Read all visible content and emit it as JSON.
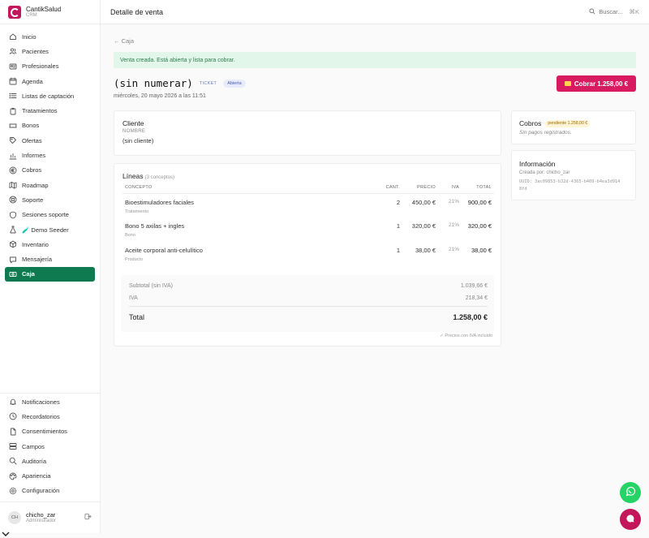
{
  "brand": {
    "name": "CantikSalud",
    "sub": "CRM"
  },
  "nav": [
    {
      "id": "inicio",
      "label": "Inicio",
      "icon": "home-icon"
    },
    {
      "id": "pacientes",
      "label": "Pacientes",
      "icon": "users-icon"
    },
    {
      "id": "profesionales",
      "label": "Profesionales",
      "icon": "id-card-icon"
    },
    {
      "id": "agenda",
      "label": "Agenda",
      "icon": "calendar-icon"
    },
    {
      "id": "listas",
      "label": "Listas de captación",
      "icon": "list-icon"
    },
    {
      "id": "tratamientos",
      "label": "Tratamientos",
      "icon": "clipboard-icon"
    },
    {
      "id": "bonos",
      "label": "Bonos",
      "icon": "ticket-icon"
    },
    {
      "id": "ofertas",
      "label": "Ofertas",
      "icon": "tag-icon"
    },
    {
      "id": "informes",
      "label": "Informes",
      "icon": "chart-icon"
    },
    {
      "id": "cobros",
      "label": "Cobros",
      "icon": "euro-icon"
    },
    {
      "id": "roadmap",
      "label": "Roadmap",
      "icon": "map-icon"
    },
    {
      "id": "soporte",
      "label": "Soporte",
      "icon": "lifebuoy-icon"
    },
    {
      "id": "sesiones",
      "label": "Sesiones soporte",
      "icon": "shield-icon"
    },
    {
      "id": "demo",
      "label": "🧪 Demo Seeder",
      "icon": "flask-icon"
    },
    {
      "id": "inventario",
      "label": "Inventario",
      "icon": "box-icon"
    },
    {
      "id": "mensajeria",
      "label": "Mensajería",
      "icon": "message-icon"
    },
    {
      "id": "caja",
      "label": "Caja",
      "icon": "cash-icon",
      "active": true
    }
  ],
  "nav_bottom": [
    {
      "id": "notificaciones",
      "label": "Notificaciones",
      "icon": "bell-icon"
    },
    {
      "id": "recordatorios",
      "label": "Recordatorios",
      "icon": "clock-icon"
    },
    {
      "id": "consentimientos",
      "label": "Consentimientos",
      "icon": "file-icon"
    },
    {
      "id": "campos",
      "label": "Campos",
      "icon": "fields-icon"
    },
    {
      "id": "auditoria",
      "label": "Auditoría",
      "icon": "search-icon"
    },
    {
      "id": "apariencia",
      "label": "Apariencia",
      "icon": "palette-icon"
    },
    {
      "id": "configuracion",
      "label": "Configuración",
      "icon": "gear-icon"
    }
  ],
  "user": {
    "initials": "CH",
    "name": "chicho_zar",
    "role": "Administrador"
  },
  "topbar": {
    "title": "Detalle de venta",
    "search_placeholder": "Buscar...",
    "search_shortcut": "⌘K"
  },
  "page": {
    "back_label": "← Caja",
    "alert": "Venta creada. Está abierta y lista para cobrar.",
    "title": "(sin numerar)",
    "tag": "TICKET",
    "status": "Abierta",
    "date": "miércoles, 20 mayo 2026 a las 11:51",
    "cobrar_button": "Cobrar  1.258,00 €"
  },
  "cliente": {
    "title": "Cliente",
    "label": "NOMBRE",
    "value": "(sin cliente)"
  },
  "lineas": {
    "title": "Líneas",
    "count": "(3 conceptos)",
    "headers": {
      "concepto": "CONCEPTO",
      "cant": "CANT.",
      "precio": "PRECIO",
      "iva": "IVA",
      "total": "TOTAL"
    },
    "rows": [
      {
        "concepto": "Bioestimuladores faciales",
        "tipo": "Tratamiento",
        "cant": "2",
        "precio": "450,00 €",
        "iva": "21%",
        "total": "900,00 €"
      },
      {
        "concepto": "Bono 5 axilas + ingles",
        "tipo": "Bono",
        "cant": "1",
        "precio": "320,00 €",
        "iva": "21%",
        "total": "320,00 €"
      },
      {
        "concepto": "Aceite corporal anti-celulítico",
        "tipo": "Producto",
        "cant": "1",
        "precio": "38,00 €",
        "iva": "21%",
        "total": "38,00 €"
      }
    ],
    "subtotal_label": "Subtotal (sin IVA)",
    "subtotal_value": "1.039,66 €",
    "iva_label": "IVA",
    "iva_value": "218,34 €",
    "total_label": "Total",
    "total_value": "1.258,00 €",
    "footnote": "✓ Precios con IVA incluido"
  },
  "cobros": {
    "title": "Cobros",
    "pending": "pendiente 1.258,00 €",
    "empty": "Sin pagos registrados."
  },
  "informacion": {
    "title": "Información",
    "creada": "Creada por: chicho_zar",
    "uuid": "UUID: 3ac09853-b32d-4365-b409-b4ea3d9148fd"
  },
  "colors": {
    "accent": "#d81b60",
    "active_nav": "#0f7a4f",
    "alert_bg": "#e2f6ea",
    "whatsapp": "#25d366"
  }
}
